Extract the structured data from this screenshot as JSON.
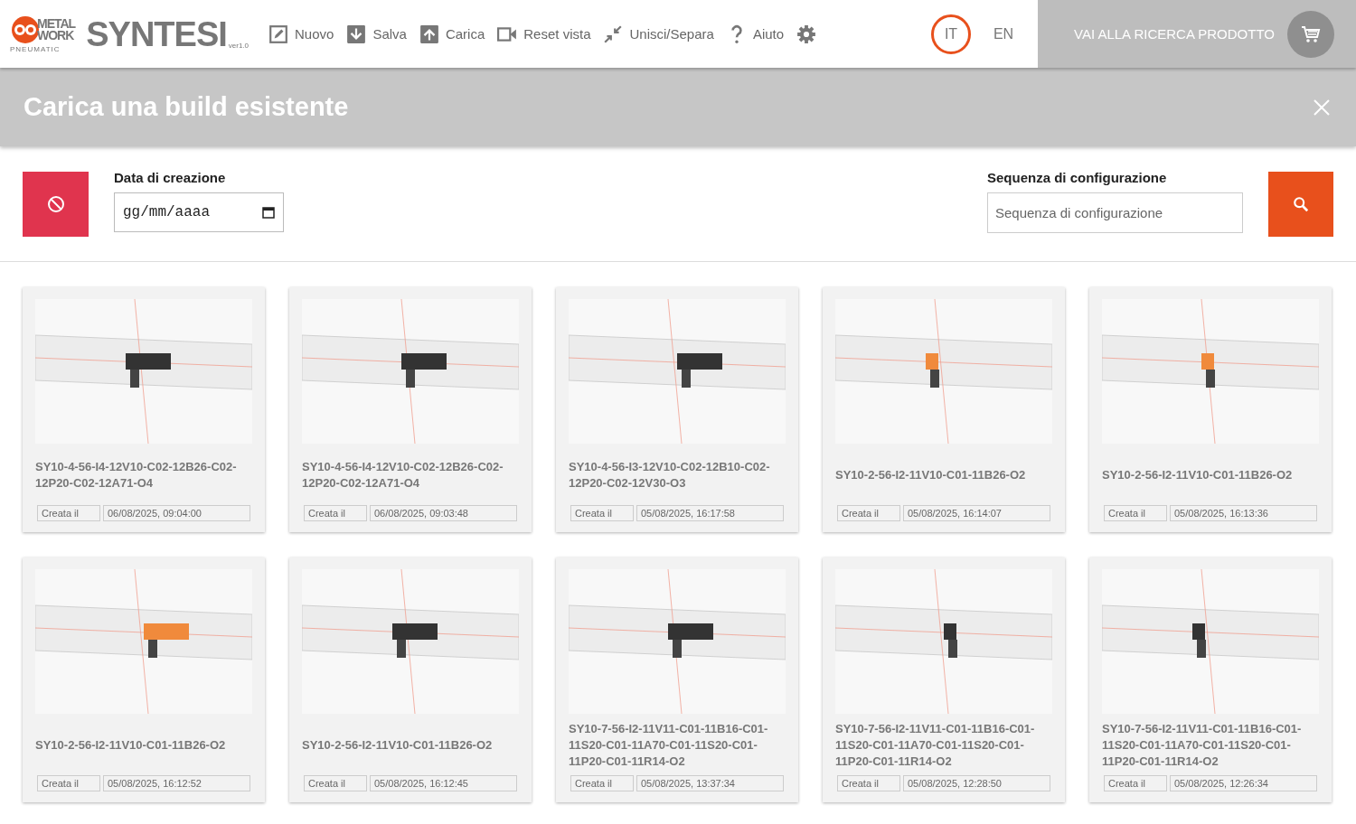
{
  "logo": {
    "brand_top": "METAL",
    "brand_bottom": "WORK",
    "brand_sub": "PNEUMATIC",
    "product": "SYNTESI",
    "version": "ver1.0"
  },
  "toolbar": [
    {
      "kind": "edit",
      "label": "Nuovo"
    },
    {
      "kind": "download",
      "label": "Salva"
    },
    {
      "kind": "upload",
      "label": "Carica"
    },
    {
      "kind": "camera",
      "label": "Reset vista"
    },
    {
      "kind": "merge",
      "label": "Unisci/Separa"
    },
    {
      "kind": "help",
      "label": "Aiuto"
    },
    {
      "kind": "settings"
    }
  ],
  "languages": [
    {
      "label": "IT",
      "selected": true
    },
    {
      "label": "EN",
      "selected": false
    }
  ],
  "product_search_button": {
    "label": "VAI ALLA RICERCA PRODOTTO"
  },
  "dialog": {
    "title": "Carica una build esistente"
  },
  "filters": {
    "date_label": "Data di creazione",
    "date_placeholder": "gg/mm/aaaa",
    "sequence_label": "Sequenza di configurazione",
    "sequence_placeholder": "Sequenza di configurazione"
  },
  "builds": [
    {
      "code": "SY10-4-56-I4-12V10-C02-12B26-C02-12P20-C02-12A71-O4",
      "created_label": "Creata il",
      "created": "06/08/2025, 09:04:00"
    },
    {
      "code": "SY10-4-56-I4-12V10-C02-12B26-C02-12P20-C02-12A71-O4",
      "created_label": "Creata il",
      "created": "06/08/2025, 09:03:48"
    },
    {
      "code": "SY10-4-56-I3-12V10-C02-12B10-C02-12P20-C02-12V30-O3",
      "created_label": "Creata il",
      "created": "05/08/2025, 16:17:58"
    },
    {
      "code": "SY10-2-56-I2-11V10-C01-11B26-O2",
      "created_label": "Creata il",
      "created": "05/08/2025, 16:14:07"
    },
    {
      "code": "SY10-2-56-I2-11V10-C01-11B26-O2",
      "created_label": "Creata il",
      "created": "05/08/2025, 16:13:36"
    },
    {
      "code": "SY10-2-56-I2-11V10-C01-11B26-O2",
      "created_label": "Creata il",
      "created": "05/08/2025, 16:12:52"
    },
    {
      "code": "SY10-2-56-I2-11V10-C01-11B26-O2",
      "created_label": "Creata il",
      "created": "05/08/2025, 16:12:45"
    },
    {
      "code": "SY10-7-56-I2-11V11-C01-11B16-C01-11S20-C01-11A70-C01-11S20-C01-11P20-C01-11R14-O2",
      "created_label": "Creata il",
      "created": "05/08/2025, 13:37:34"
    },
    {
      "code": "SY10-7-56-I2-11V11-C01-11B16-C01-11S20-C01-11A70-C01-11S20-C01-11P20-C01-11R14-O2",
      "created_label": "Creata il",
      "created": "05/08/2025, 12:28:50"
    },
    {
      "code": "SY10-7-56-I2-11V11-C01-11B16-C01-11S20-C01-11A70-C01-11S20-C01-11P20-C01-11R14-O2",
      "created_label": "Creata il",
      "created": "05/08/2025, 12:26:34"
    }
  ]
}
